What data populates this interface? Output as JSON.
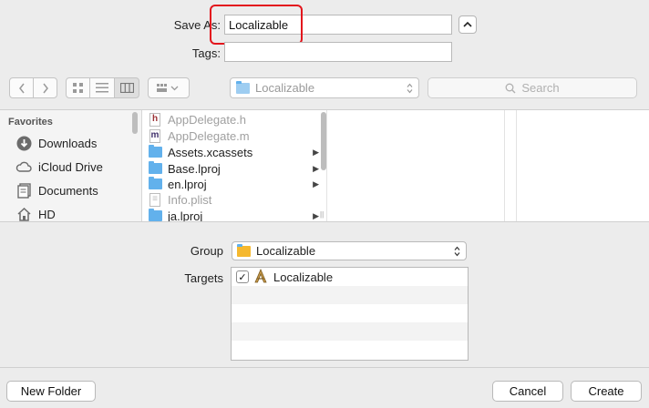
{
  "save_as": {
    "label": "Save As:",
    "value": "Localizable"
  },
  "tags": {
    "label": "Tags:",
    "value": ""
  },
  "toolbar": {
    "location": "Localizable",
    "search_placeholder": "Search"
  },
  "sidebar": {
    "heading": "Favorites",
    "items": [
      {
        "label": "Downloads"
      },
      {
        "label": "iCloud Drive"
      },
      {
        "label": "Documents"
      },
      {
        "label": "HD"
      }
    ]
  },
  "files": [
    {
      "name": "AppDelegate.h",
      "kind": "h-file",
      "badge": "h",
      "dim": true,
      "folder": false
    },
    {
      "name": "AppDelegate.m",
      "kind": "m-file",
      "badge": "m",
      "dim": true,
      "folder": false
    },
    {
      "name": "Assets.xcassets",
      "kind": "folder",
      "dim": false,
      "folder": true
    },
    {
      "name": "Base.lproj",
      "kind": "folder",
      "dim": false,
      "folder": true
    },
    {
      "name": "en.lproj",
      "kind": "folder",
      "dim": false,
      "folder": true
    },
    {
      "name": "Info.plist",
      "kind": "plist",
      "dim": true,
      "folder": false
    },
    {
      "name": "ja.lproj",
      "kind": "folder",
      "dim": false,
      "folder": true
    }
  ],
  "group": {
    "label": "Group",
    "value": "Localizable"
  },
  "targets": {
    "label": "Targets",
    "items": [
      {
        "name": "Localizable",
        "checked": true
      }
    ]
  },
  "buttons": {
    "new_folder": "New Folder",
    "cancel": "Cancel",
    "create": "Create"
  }
}
